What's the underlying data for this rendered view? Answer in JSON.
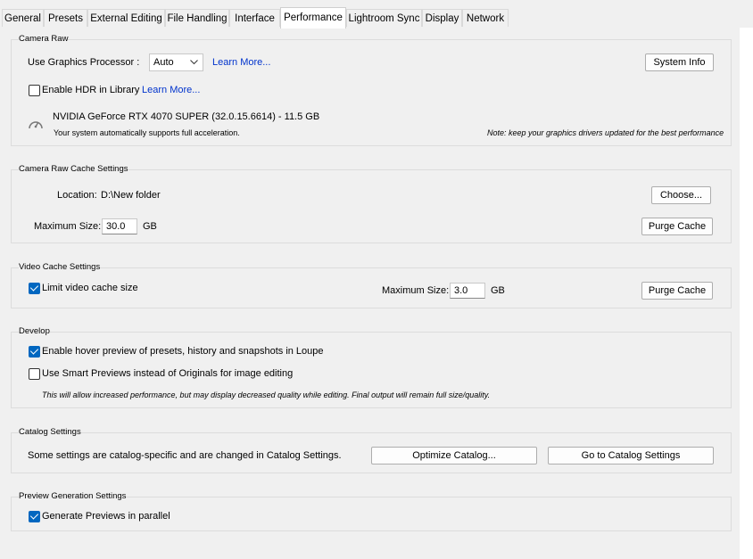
{
  "tabs": [
    "General",
    "Presets",
    "External Editing",
    "File Handling",
    "Interface",
    "Performance",
    "Lightroom Sync",
    "Display",
    "Network"
  ],
  "active_tab": "Performance",
  "camera_raw": {
    "title": "Camera Raw",
    "gpu_label": "Use Graphics Processor :",
    "gpu_value": "Auto",
    "learn_more_1": "Learn More...",
    "system_info_button": "System Info",
    "enable_hdr_label": "Enable HDR in Library",
    "enable_hdr_checked": false,
    "learn_more_2": "Learn More...",
    "gpu_name": "NVIDIA GeForce RTX 4070 SUPER (32.0.15.6614) - 11.5 GB",
    "accel_text": "Your system automatically supports full acceleration.",
    "note_text": "Note: keep your graphics drivers updated for the best performance"
  },
  "cache": {
    "title": "Camera Raw Cache Settings",
    "location_label": "Location:",
    "location_value": "D:\\New folder",
    "choose_button": "Choose...",
    "max_size_label": "Maximum Size:",
    "max_size_value": "30.0",
    "unit": "GB",
    "purge_button": "Purge Cache"
  },
  "video": {
    "title": "Video Cache Settings",
    "limit_label": "Limit video cache size",
    "limit_checked": true,
    "max_size_label": "Maximum Size:",
    "max_size_value": "3.0",
    "unit": "GB",
    "purge_button": "Purge Cache"
  },
  "develop": {
    "title": "Develop",
    "hover_label": "Enable hover preview of presets, history and snapshots in Loupe",
    "hover_checked": true,
    "smart_label": "Use Smart Previews instead of Originals for image editing",
    "smart_checked": false,
    "smart_note": "This will allow increased performance, but may display decreased quality while editing. Final output will remain full size/quality."
  },
  "catalog": {
    "title": "Catalog Settings",
    "text": "Some settings are catalog-specific and are changed in Catalog Settings.",
    "optimize_button": "Optimize Catalog...",
    "goto_button": "Go to Catalog Settings"
  },
  "preview": {
    "title": "Preview Generation Settings",
    "parallel_label": "Generate Previews in parallel",
    "parallel_checked": true
  },
  "colors": {
    "accent": "#0067c0",
    "link": "#0033cc"
  }
}
